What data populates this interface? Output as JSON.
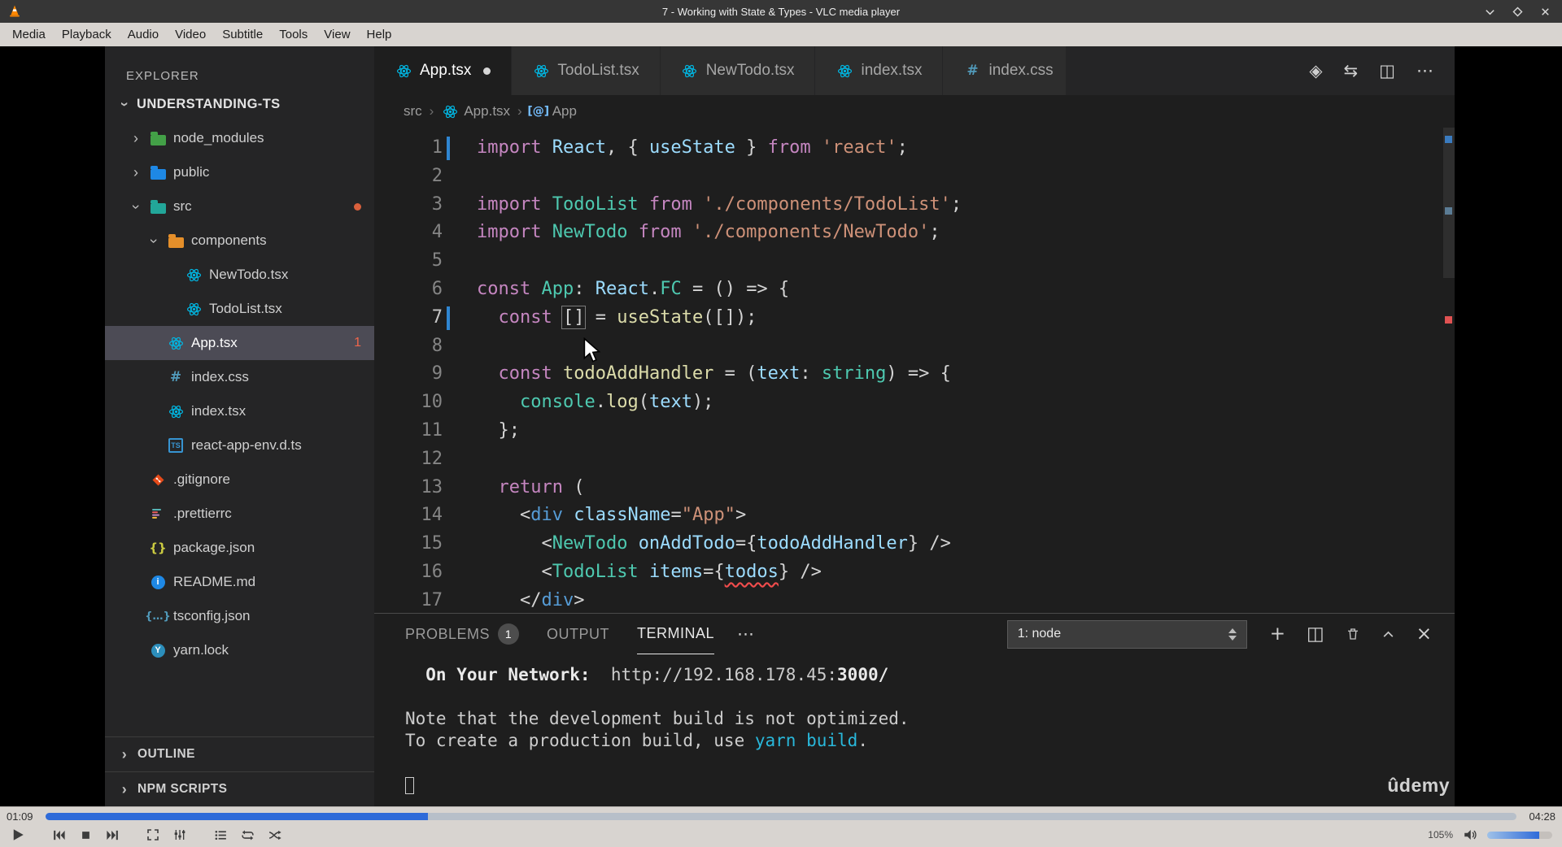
{
  "watermark": "ûdemy",
  "vlc": {
    "window_title": "7 - Working with State & Types - VLC media player",
    "menu_items": [
      "Media",
      "Playback",
      "Audio",
      "Video",
      "Subtitle",
      "Tools",
      "View",
      "Help"
    ],
    "window_controls": [
      {
        "name": "minimize-button",
        "icon": "winmin"
      },
      {
        "name": "maximize-button",
        "icon": "winmax"
      },
      {
        "name": "close-button",
        "icon": "winclose"
      }
    ],
    "time_elapsed": "01:09",
    "time_total": "04:28",
    "seek_percent": 26,
    "volume_label": "105%",
    "volume_percent": 80,
    "controls": [
      {
        "name": "play-button",
        "icon": "play"
      },
      {
        "name": "previous-button",
        "icon": "prev",
        "gap_before": true
      },
      {
        "name": "stop-button",
        "icon": "stop"
      },
      {
        "name": "next-button",
        "icon": "next"
      },
      {
        "name": "fullscreen-button",
        "icon": "fullscreen",
        "gap_before": true
      },
      {
        "name": "extended-settings-button",
        "icon": "sliders"
      },
      {
        "name": "playlist-button",
        "icon": "playlist",
        "gap_before": true
      },
      {
        "name": "loop-button",
        "icon": "loop"
      },
      {
        "name": "random-button",
        "icon": "shuffle"
      }
    ]
  },
  "vscode": {
    "explorer": {
      "header": "EXPLORER",
      "root": "UNDERSTANDING-TS",
      "items": [
        {
          "label": "node_modules",
          "indent": 1,
          "chevron": "closed",
          "icon": "folder",
          "color": "#43a047"
        },
        {
          "label": "public",
          "indent": 1,
          "chevron": "closed",
          "icon": "folder",
          "color": "#1e88e5"
        },
        {
          "label": "src",
          "indent": 1,
          "chevron": "open",
          "icon": "folder",
          "color": "#22a699",
          "dot": true
        },
        {
          "label": "components",
          "indent": 2,
          "chevron": "open",
          "icon": "folder",
          "color": "#e58f2a"
        },
        {
          "label": "NewTodo.tsx",
          "indent": 3,
          "icon": "react"
        },
        {
          "label": "TodoList.tsx",
          "indent": 3,
          "icon": "react"
        },
        {
          "label": "App.tsx",
          "indent": 2,
          "icon": "react",
          "selected": true,
          "badge": "1"
        },
        {
          "label": "index.css",
          "indent": 2,
          "icon": "css"
        },
        {
          "label": "index.tsx",
          "indent": 2,
          "icon": "react"
        },
        {
          "label": "react-app-env.d.ts",
          "indent": 2,
          "icon": "ts"
        },
        {
          "label": ".gitignore",
          "indent": 1,
          "icon": "git"
        },
        {
          "label": ".prettierrc",
          "indent": 1,
          "icon": "prettier"
        },
        {
          "label": "package.json",
          "indent": 1,
          "icon": "json"
        },
        {
          "label": "README.md",
          "indent": 1,
          "icon": "info"
        },
        {
          "label": "tsconfig.json",
          "indent": 1,
          "icon": "braces"
        },
        {
          "label": "yarn.lock",
          "indent": 1,
          "icon": "yarn"
        }
      ],
      "sections": [
        "OUTLINE",
        "NPM SCRIPTS"
      ]
    },
    "tabs": [
      {
        "label": "App.tsx",
        "icon": "react",
        "active": true,
        "modified": true
      },
      {
        "label": "TodoList.tsx",
        "icon": "react"
      },
      {
        "label": "NewTodo.tsx",
        "icon": "react"
      },
      {
        "label": "index.tsx",
        "icon": "react"
      },
      {
        "label": "index.css",
        "icon": "css"
      }
    ],
    "editor_actions": [
      {
        "name": "open-changes-icon",
        "glyph": "◈"
      },
      {
        "name": "git-compare-icon",
        "glyph": "⇆"
      },
      {
        "name": "split-editor-icon",
        "glyph": "◫"
      },
      {
        "name": "more-actions-icon",
        "glyph": "⋯"
      }
    ],
    "breadcrumb": [
      {
        "label": "src"
      },
      {
        "label": "App.tsx",
        "icon": "react"
      },
      {
        "label": "App",
        "icon": "symbol"
      }
    ],
    "code": {
      "lines": [
        {
          "n": "1",
          "modified": true,
          "tokens": [
            [
              "k",
              "import "
            ],
            [
              "b",
              "React"
            ],
            [
              "d",
              ", { "
            ],
            [
              "b",
              "useState"
            ],
            [
              "d",
              " } "
            ],
            [
              "k",
              "from"
            ],
            [
              "d",
              " "
            ],
            [
              "o",
              "'react'"
            ],
            [
              "d",
              ";"
            ]
          ]
        },
        {
          "n": "2",
          "tokens": []
        },
        {
          "n": "3",
          "tokens": [
            [
              "k",
              "import "
            ],
            [
              "t",
              "TodoList"
            ],
            [
              "d",
              " "
            ],
            [
              "k",
              "from"
            ],
            [
              "d",
              " "
            ],
            [
              "o",
              "'./components/TodoList'"
            ],
            [
              "d",
              ";"
            ]
          ]
        },
        {
          "n": "4",
          "tokens": [
            [
              "k",
              "import "
            ],
            [
              "t",
              "NewTodo"
            ],
            [
              "d",
              " "
            ],
            [
              "k",
              "from"
            ],
            [
              "d",
              " "
            ],
            [
              "o",
              "'./components/NewTodo'"
            ],
            [
              "d",
              ";"
            ]
          ]
        },
        {
          "n": "5",
          "tokens": []
        },
        {
          "n": "6",
          "tokens": [
            [
              "k",
              "const "
            ],
            [
              "t",
              "App"
            ],
            [
              "d",
              ": "
            ],
            [
              "b",
              "React"
            ],
            [
              "d",
              "."
            ],
            [
              "t",
              "FC"
            ],
            [
              "d",
              " = () => {"
            ]
          ]
        },
        {
          "n": "7",
          "modified": true,
          "active": true,
          "tokens": [
            [
              "d",
              "  "
            ],
            [
              "k",
              "const "
            ],
            [
              "box",
              "[]"
            ],
            [
              "d",
              " = "
            ],
            [
              "y",
              "useState"
            ],
            [
              "d",
              "([]);"
            ]
          ]
        },
        {
          "n": "8",
          "tokens": []
        },
        {
          "n": "9",
          "tokens": [
            [
              "d",
              "  "
            ],
            [
              "k",
              "const "
            ],
            [
              "y",
              "todoAddHandler"
            ],
            [
              "d",
              " = ("
            ],
            [
              "b",
              "text"
            ],
            [
              "d",
              ": "
            ],
            [
              "t",
              "string"
            ],
            [
              "d",
              ") => {"
            ]
          ]
        },
        {
          "n": "10",
          "tokens": [
            [
              "d",
              "    "
            ],
            [
              "t",
              "console"
            ],
            [
              "d",
              "."
            ],
            [
              "y",
              "log"
            ],
            [
              "d",
              "("
            ],
            [
              "b",
              "text"
            ],
            [
              "d",
              ");"
            ]
          ]
        },
        {
          "n": "11",
          "tokens": [
            [
              "d",
              "  };"
            ]
          ]
        },
        {
          "n": "12",
          "tokens": []
        },
        {
          "n": "13",
          "tokens": [
            [
              "d",
              "  "
            ],
            [
              "k",
              "return"
            ],
            [
              "d",
              " ("
            ]
          ]
        },
        {
          "n": "14",
          "tokens": [
            [
              "d",
              "    <"
            ],
            [
              "g",
              "div"
            ],
            [
              "d",
              " "
            ],
            [
              "b",
              "className"
            ],
            [
              "d",
              "="
            ],
            [
              "o",
              "\"App\""
            ],
            [
              "d",
              ">"
            ]
          ]
        },
        {
          "n": "15",
          "tokens": [
            [
              "d",
              "      <"
            ],
            [
              "t",
              "NewTodo"
            ],
            [
              "d",
              " "
            ],
            [
              "b",
              "onAddTodo"
            ],
            [
              "d",
              "={"
            ],
            [
              "b",
              "todoAddHandler"
            ],
            [
              "d",
              "} />"
            ]
          ]
        },
        {
          "n": "16",
          "tokens": [
            [
              "d",
              "      <"
            ],
            [
              "t",
              "TodoList"
            ],
            [
              "d",
              " "
            ],
            [
              "b",
              "items"
            ],
            [
              "d",
              "={"
            ],
            [
              "e",
              "todos"
            ],
            [
              "d",
              "} />"
            ]
          ]
        },
        {
          "n": "17",
          "tokens": [
            [
              "d",
              "    </"
            ],
            [
              "g",
              "div"
            ],
            [
              "d",
              ">"
            ]
          ]
        }
      ]
    },
    "panel": {
      "tabs": [
        {
          "label": "PROBLEMS",
          "badge": "1"
        },
        {
          "label": "OUTPUT"
        },
        {
          "label": "TERMINAL",
          "active": true
        }
      ],
      "more_glyph": "⋯",
      "dropdown": "1: node",
      "actions": [
        {
          "name": "new-terminal-icon",
          "glyph": "+"
        },
        {
          "name": "split-terminal-icon",
          "glyph": "◫"
        },
        {
          "name": "kill-terminal-icon",
          "glyph": "@trash"
        },
        {
          "name": "maximize-panel-icon",
          "glyph": "@chevup"
        },
        {
          "name": "close-panel-icon",
          "glyph": "×"
        }
      ],
      "lines": [
        {
          "segments": [
            [
              "wb",
              "  On Your Network:  "
            ],
            [
              "w",
              "http://192.168.178.45:"
            ],
            [
              "wb",
              "3000/"
            ]
          ]
        },
        {
          "segments": []
        },
        {
          "segments": [
            [
              "w",
              "Note that the development build is not optimized."
            ]
          ]
        },
        {
          "segments": [
            [
              "w",
              "To create a production build, use "
            ],
            [
              "c",
              "yarn build"
            ],
            [
              "w",
              "."
            ]
          ]
        },
        {
          "segments": []
        },
        {
          "segments": [
            [
              "cursor",
              ""
            ]
          ]
        }
      ]
    }
  },
  "colors": {
    "seek_fill": "#2f6bd9",
    "error": "#f14c4c",
    "terminal_link": "#29b8db",
    "modified_gutter": "#2f86d2"
  }
}
